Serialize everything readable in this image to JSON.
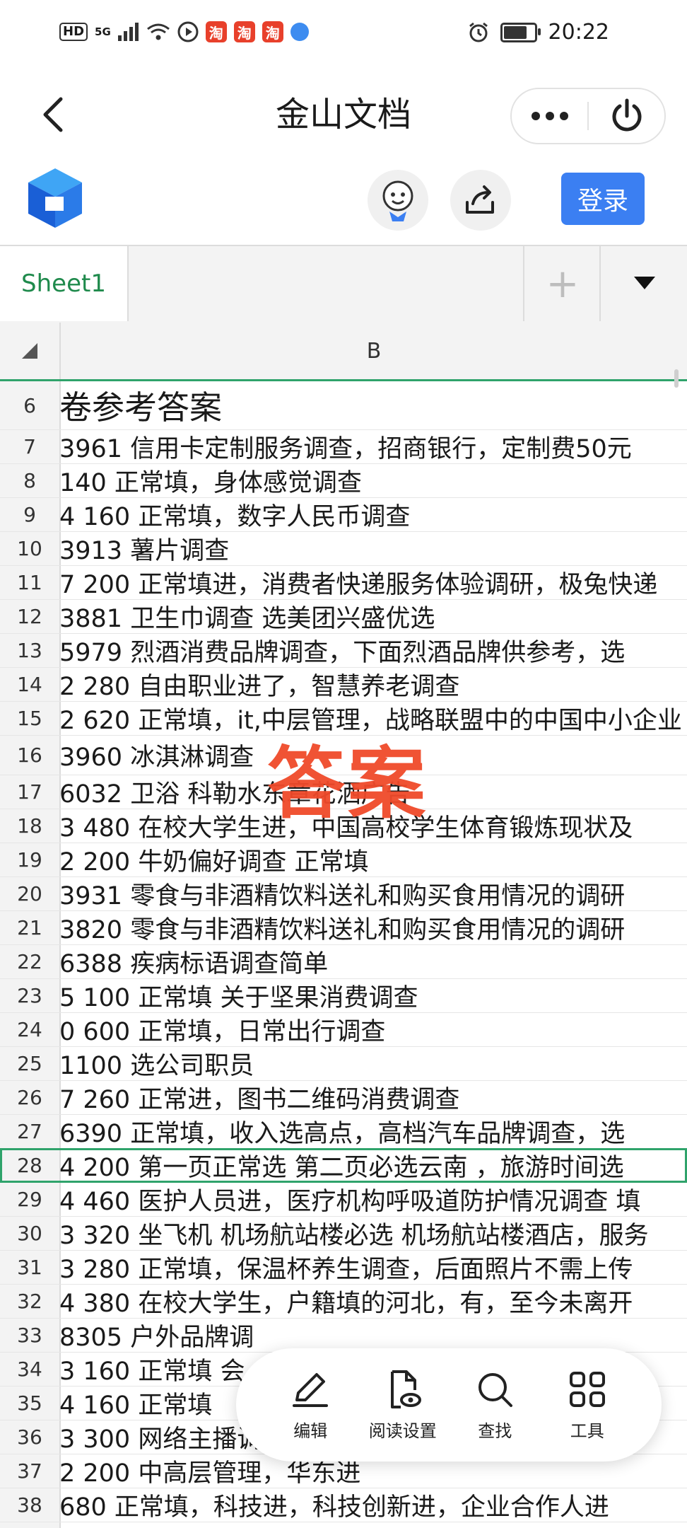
{
  "status_bar": {
    "left_badges": [
      "HD",
      "5G"
    ],
    "shop_icon_text": "淘",
    "time": "20:22"
  },
  "title_bar": {
    "title": "金山文档"
  },
  "app_toolbar": {
    "login_label": "登录"
  },
  "sheet_tabs": {
    "active_tab": "Sheet1",
    "add_symbol": "+"
  },
  "grid": {
    "column_header": "B",
    "rows": [
      {
        "num": "6",
        "text": "卷参考答案"
      },
      {
        "num": "7",
        "text": "  3961 信用卡定制服务调查，招商银行，定制费50元"
      },
      {
        "num": "8",
        "text": "  140 正常填，身体感觉调查"
      },
      {
        "num": "9",
        "text": "4 160 正常填，数字人民币调查"
      },
      {
        "num": "10",
        "text": "  3913 薯片调查"
      },
      {
        "num": "11",
        "text": "7 200  正常填进，消费者快递服务体验调研，极兔快递"
      },
      {
        "num": "12",
        "text": "  3881 卫生巾调查 选美团兴盛优选"
      },
      {
        "num": "13",
        "text": "  5979 烈酒消费品牌调查，下面烈酒品牌供参考，选"
      },
      {
        "num": "14",
        "text": "2 280 自由职业进了，智慧养老调查"
      },
      {
        "num": "15",
        "text": "2 620 正常填，it,中层管理，战略联盟中的中国中小企业"
      },
      {
        "num": "16",
        "text": "  3960 冰淇淋调查"
      },
      {
        "num": "17",
        "text": "  6032 卫浴 科勒水东章花洒广告"
      },
      {
        "num": "18",
        "text": "3 480 在校大学生进，中国高校学生体育锻炼现状及"
      },
      {
        "num": "19",
        "text": "2 200 牛奶偏好调查  正常填"
      },
      {
        "num": "20",
        "text": "  3931 零食与非酒精饮料送礼和购买食用情况的调研"
      },
      {
        "num": "21",
        "text": "  3820 零食与非酒精饮料送礼和购买食用情况的调研"
      },
      {
        "num": "22",
        "text": "  6388 疾病标语调查简单"
      },
      {
        "num": "23",
        "text": "5 100 正常填 关于坚果消费调查"
      },
      {
        "num": "24",
        "text": "0 600 正常填，日常出行调查"
      },
      {
        "num": "25",
        "text": "   1100 选公司职员"
      },
      {
        "num": "26",
        "text": "7 260 正常进，图书二维码消费调查"
      },
      {
        "num": "27",
        "text": "  6390 正常填，收入选高点，高档汽车品牌调查，选"
      },
      {
        "num": "28",
        "text": "4 200 第一页正常选 第二页必选云南 ，旅游时间选"
      },
      {
        "num": "29",
        "text": "4 460 医护人员进，医疗机构呼吸道防护情况调查 填"
      },
      {
        "num": "30",
        "text": "3 320 坐飞机 机场航站楼必选  机场航站楼酒店，服务"
      },
      {
        "num": "31",
        "text": "3 280 正常填，保温杯养生调查，后面照片不需上传"
      },
      {
        "num": "32",
        "text": "4 380 在校大学生，户籍填的河北，有，至今未离开"
      },
      {
        "num": "33",
        "text": "  8305 户外品牌调"
      },
      {
        "num": "34",
        "text": "3 160 正常填 会"
      },
      {
        "num": "35",
        "text": "4 160 正常填"
      },
      {
        "num": "36",
        "text": "3 300 网络主播调查"
      },
      {
        "num": "37",
        "text": "2 200 中高层管理，华东进"
      },
      {
        "num": "38",
        "text": "  680 正常填，科技进，科技创新进，企业合作人进"
      }
    ]
  },
  "watermark": {
    "text": "答案"
  },
  "bottom_toolbar": {
    "items": [
      {
        "label": "编辑",
        "icon": "edit-icon"
      },
      {
        "label": "阅读设置",
        "icon": "reading-settings-icon"
      },
      {
        "label": "查找",
        "icon": "search-icon"
      },
      {
        "label": "工具",
        "icon": "apps-grid-icon"
      }
    ]
  },
  "colors": {
    "accent_green": "#2fa36b",
    "login_blue": "#3b7ff2",
    "watermark_red": "#f04a2a"
  }
}
